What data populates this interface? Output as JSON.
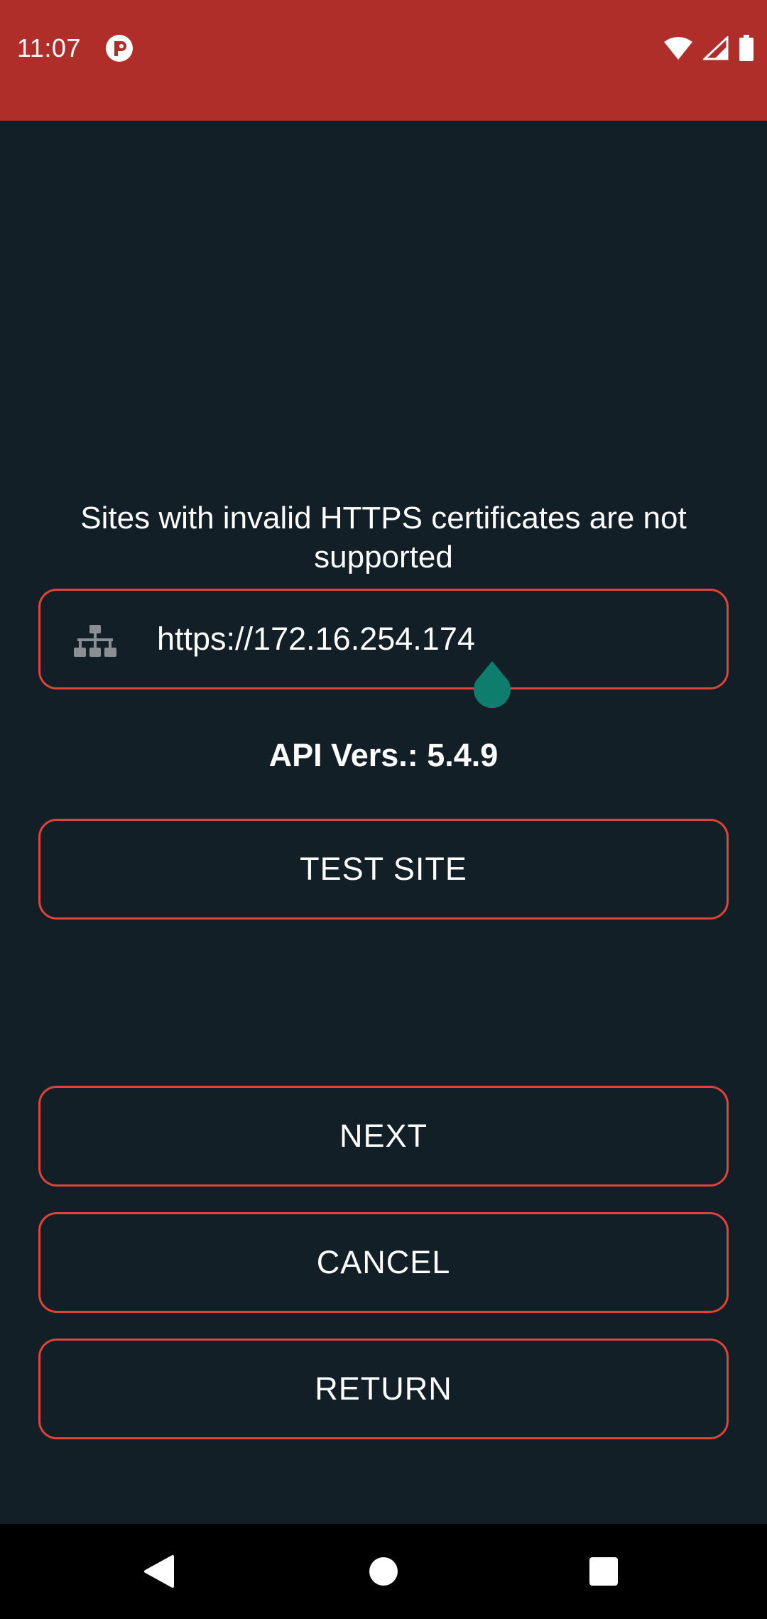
{
  "status_bar": {
    "time": "11:07",
    "app_icon": "p-circle-icon",
    "icons": [
      "wifi-icon",
      "signal-icon",
      "battery-icon"
    ],
    "color": "#b02e29"
  },
  "setup": {
    "warning": "Sites with invalid HTTPS certificates are not supported",
    "url_field": {
      "icon": "network-icon",
      "value": "https://172.16.254.174"
    },
    "api_version": "API Vers.: 5.4.9",
    "test_button_label": "TEST SITE",
    "next_button_label": "NEXT",
    "cancel_button_label": "CANCEL",
    "return_button_label": "RETURN"
  },
  "colors": {
    "background": "#121f26",
    "outline": "#e0433a",
    "cursor_handle": "#0e7d6e"
  },
  "nav_bar": {
    "buttons": [
      "back-icon",
      "home-icon",
      "recents-icon"
    ]
  }
}
